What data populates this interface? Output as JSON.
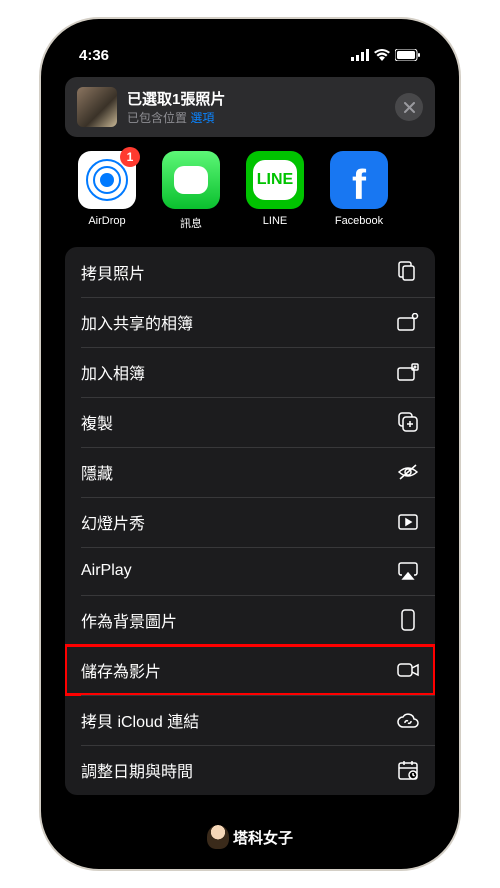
{
  "status": {
    "time": "4:36"
  },
  "header": {
    "title": "已選取1張照片",
    "subtitle_prefix": "已包含位置",
    "subtitle_link": "選項",
    "badge_count": "1"
  },
  "apps": [
    {
      "label": "AirDrop"
    },
    {
      "label": "訊息"
    },
    {
      "label": "LINE"
    },
    {
      "label": "Facebook"
    }
  ],
  "actions": [
    {
      "label": "拷貝照片",
      "icon": "copy"
    },
    {
      "label": "加入共享的相簿",
      "icon": "shared-album"
    },
    {
      "label": "加入相簿",
      "icon": "album"
    },
    {
      "label": "複製",
      "icon": "duplicate"
    },
    {
      "label": "隱藏",
      "icon": "hide"
    },
    {
      "label": "幻燈片秀",
      "icon": "play"
    },
    {
      "label": "AirPlay",
      "icon": "airplay"
    },
    {
      "label": "作為背景圖片",
      "icon": "wallpaper"
    },
    {
      "label": "儲存為影片",
      "icon": "video",
      "highlight": true
    },
    {
      "label": "拷貝 iCloud 連結",
      "icon": "cloud"
    },
    {
      "label": "調整日期與時間",
      "icon": "calendar"
    }
  ],
  "watermark": "塔科女子"
}
